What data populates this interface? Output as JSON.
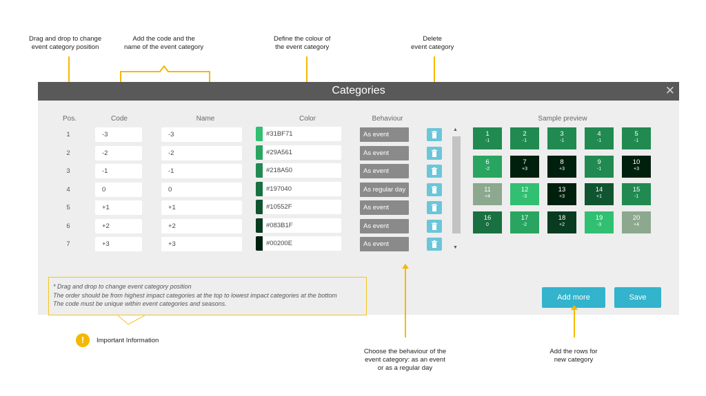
{
  "callouts": {
    "drag": [
      "Drag and drop to change",
      "event category position"
    ],
    "code_name": [
      "Add the code and the",
      "name of the event category"
    ],
    "colour": [
      "Define the colour of",
      "the event category"
    ],
    "delete": [
      "Delete",
      "event category"
    ],
    "behaviour": [
      "Choose the behaviour of the",
      "event category: as an event",
      "or as a regular day"
    ],
    "add": [
      "Add the rows for",
      "new category"
    ],
    "important": "Important Information"
  },
  "dialog": {
    "title": "Categories",
    "close_glyph": "✕",
    "columns": {
      "pos": "Pos.",
      "code": "Code",
      "name": "Name",
      "color": "Color",
      "behaviour": "Behaviour"
    },
    "rows": [
      {
        "pos": "1",
        "code": "-3",
        "name": "-3",
        "color": "#31BF71",
        "behaviour": "As event"
      },
      {
        "pos": "2",
        "code": "-2",
        "name": "-2",
        "color": "#29A561",
        "behaviour": "As event"
      },
      {
        "pos": "3",
        "code": "-1",
        "name": "-1",
        "color": "#218A50",
        "behaviour": "As event"
      },
      {
        "pos": "4",
        "code": "0",
        "name": "0",
        "color": "#197040",
        "behaviour": "As regular day"
      },
      {
        "pos": "5",
        "code": "+1",
        "name": "+1",
        "color": "#10552F",
        "behaviour": "As event"
      },
      {
        "pos": "6",
        "code": "+2",
        "name": "+2",
        "color": "#083B1F",
        "behaviour": "As event"
      },
      {
        "pos": "7",
        "code": "+3",
        "name": "+3",
        "color": "#00200E",
        "behaviour": "As event"
      }
    ],
    "preview_title": "Sample preview",
    "preview_tiles": [
      {
        "num": "1",
        "code": "-1",
        "color": "#218A50"
      },
      {
        "num": "2",
        "code": "-1",
        "color": "#218A50"
      },
      {
        "num": "3",
        "code": "-1",
        "color": "#218A50"
      },
      {
        "num": "4",
        "code": "-1",
        "color": "#218A50"
      },
      {
        "num": "5",
        "code": "-1",
        "color": "#218A50"
      },
      {
        "num": "6",
        "code": "-2",
        "color": "#29A561"
      },
      {
        "num": "7",
        "code": "+3",
        "color": "#00200E"
      },
      {
        "num": "8",
        "code": "+3",
        "color": "#00200E"
      },
      {
        "num": "9",
        "code": "-1",
        "color": "#218A50"
      },
      {
        "num": "10",
        "code": "+3",
        "color": "#00200E"
      },
      {
        "num": "11",
        "code": "+4",
        "color": "#8CA88E"
      },
      {
        "num": "12",
        "code": "-3",
        "color": "#31BF71"
      },
      {
        "num": "13",
        "code": "+3",
        "color": "#00200E"
      },
      {
        "num": "14",
        "code": "+1",
        "color": "#10552F"
      },
      {
        "num": "15",
        "code": "-1",
        "color": "#218A50"
      },
      {
        "num": "16",
        "code": "0",
        "color": "#197040"
      },
      {
        "num": "17",
        "code": "-2",
        "color": "#29A561"
      },
      {
        "num": "18",
        "code": "+2",
        "color": "#083B1F"
      },
      {
        "num": "19",
        "code": "-3",
        "color": "#31BF71"
      },
      {
        "num": "20",
        "code": "+4",
        "color": "#8CA88E"
      }
    ],
    "add_more": "Add more",
    "save": "Save",
    "info_lines": [
      "* Drag and drop to change event category position",
      "The order should be from highest impact categories at the top to lowest impact categories at the bottom",
      "The code must be unique within event categories and seasons."
    ],
    "trash_icon": "trash-icon"
  },
  "colors": {
    "accent": "#33b3cc",
    "titlebar": "#595959",
    "callout": "#f5b800"
  }
}
